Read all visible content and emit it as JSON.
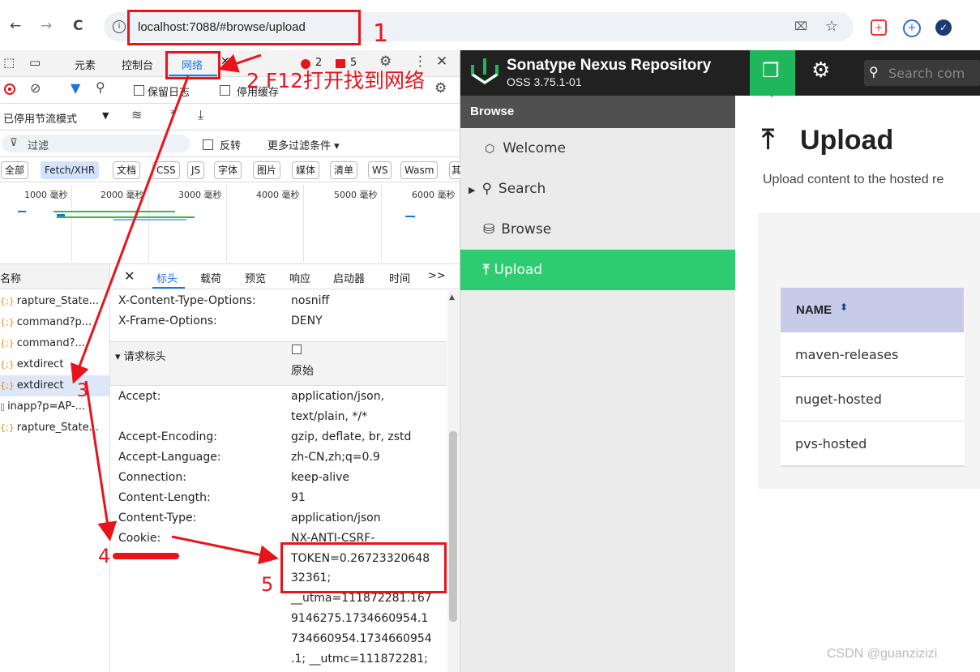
{
  "browser": {
    "url": "localhost:7088/#browse/upload",
    "back_glyph": "←",
    "forward_glyph": "→",
    "reload_glyph": "C"
  },
  "annotations": {
    "n1": "1",
    "n2": "2 F12打开找到网络",
    "n3": "3",
    "n4": "4",
    "n5": "5",
    "color": "#e8141c"
  },
  "devtools": {
    "tabs": [
      "元素",
      "控制台",
      "网络"
    ],
    "errors": "2",
    "warnings": "5",
    "toolbar": {
      "preserve_log": "保留日志",
      "disable_cache": "停用缓存",
      "throttle": "已停用节流模式"
    },
    "filter": {
      "placeholder": "过滤",
      "invert": "反转",
      "more": "更多过滤条件 ▾"
    },
    "chips": [
      "全部",
      "Fetch/XHR",
      "文档",
      "CSS",
      "JS",
      "字体",
      "图片",
      "媒体",
      "清单",
      "WS",
      "Wasm",
      "其"
    ],
    "ticks": [
      "1000 毫秒",
      "2000 毫秒",
      "3000 毫秒",
      "4000 毫秒",
      "5000 毫秒",
      "6000 毫秒"
    ],
    "name_header": "名称",
    "requests": [
      "rapture_State...",
      "command?p...",
      "command?...",
      "extdirect",
      "extdirect",
      "inapp?p=AP-...",
      "rapture_State..."
    ],
    "detail_tabs": [
      "标头",
      "载荷",
      "预览",
      "响应",
      "启动器",
      "时间",
      ">>"
    ],
    "resp_headers": [
      {
        "k": "X-Content-Type-Options:",
        "v": "nosniff"
      },
      {
        "k": "X-Frame-Options:",
        "v": "DENY"
      }
    ],
    "req_section": "▾ 请求标头",
    "raw_label": "原始",
    "req_headers": [
      {
        "k": "Accept:",
        "v": "application/json,"
      },
      {
        "k": "",
        "v": "text/plain, */*"
      },
      {
        "k": "Accept-Encoding:",
        "v": "gzip, deflate, br, zstd"
      },
      {
        "k": "Accept-Language:",
        "v": "zh-CN,zh;q=0.9"
      },
      {
        "k": "Connection:",
        "v": "keep-alive"
      },
      {
        "k": "Content-Length:",
        "v": "91"
      },
      {
        "k": "Content-Type:",
        "v": "application/json"
      },
      {
        "k": "Cookie:",
        "v": "NX-ANTI-CSRF-"
      },
      {
        "k": "",
        "v": "TOKEN=0.26723320648"
      },
      {
        "k": "",
        "v": "32361;"
      },
      {
        "k": "",
        "v": "__utma=111872281.167"
      },
      {
        "k": "",
        "v": "9146275.1734660954.1"
      },
      {
        "k": "",
        "v": "734660954.1734660954"
      },
      {
        "k": "",
        "v": ".1; __utmc=111872281;"
      }
    ]
  },
  "nexus": {
    "brand": "Sonatype Nexus Repository",
    "version": "OSS 3.75.1-01",
    "search_placeholder": "Search com",
    "side_header": "Browse",
    "side_items": [
      "Welcome",
      "Search",
      "Browse",
      "Upload"
    ],
    "page_title": "Upload",
    "page_subtitle": "Upload content to the hosted re",
    "table_header": "NAME",
    "rows": [
      "maven-releases",
      "nuget-hosted",
      "pvs-hosted"
    ],
    "accent": "#2ecc71"
  },
  "watermark": "CSDN @guanzizizi"
}
